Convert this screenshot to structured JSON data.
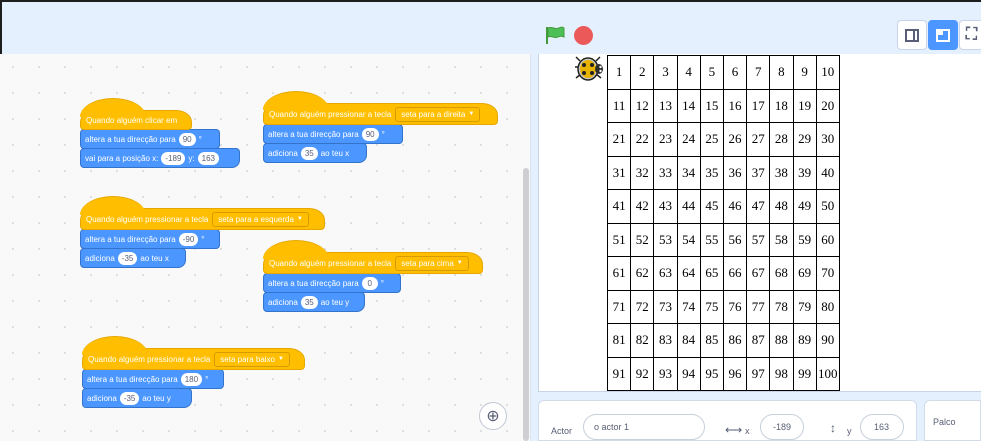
{
  "header": {
    "green_flag_icon": "green-flag-icon",
    "stop_icon": "stop-sign-icon",
    "layout_buttons": [
      "small-stage-icon",
      "large-stage-icon",
      "fullscreen-icon"
    ]
  },
  "scripts": {
    "s1": {
      "hat": "Quando alguém clicar em",
      "block1": {
        "text": "altera a tua direcção para",
        "value": "90",
        "suffix": "°"
      },
      "block2": {
        "text": "vai para a posição x:",
        "x": "-189",
        "ylabel": "y:",
        "y": "163"
      }
    },
    "s2": {
      "hat": "Quando alguém pressionar a tecla",
      "key": "seta para a direita",
      "block1": {
        "text": "altera a tua direcção para",
        "value": "90",
        "suffix": "°"
      },
      "block2": {
        "text": "adiciona",
        "value": "35",
        "suffix": "ao teu x"
      }
    },
    "s3": {
      "hat": "Quando alguém pressionar a tecla",
      "key": "seta para a esquerda",
      "block1": {
        "text": "altera a tua direcção para",
        "value": "-90",
        "suffix": "°"
      },
      "block2": {
        "text": "adiciona",
        "value": "-35",
        "suffix": "ao teu x"
      }
    },
    "s4": {
      "hat": "Quando alguém pressionar a tecla",
      "key": "seta para cima",
      "block1": {
        "text": "altera a tua direcção para",
        "value": "0",
        "suffix": "°"
      },
      "block2": {
        "text": "adiciona",
        "value": "35",
        "suffix": "ao teu y"
      }
    },
    "s5": {
      "hat": "Quando alguém pressionar a tecla",
      "key": "seta para baixo",
      "block1": {
        "text": "altera a tua direcção para",
        "value": "180",
        "suffix": "°"
      },
      "block2": {
        "text": "adiciona",
        "value": "-35",
        "suffix": "ao teu y"
      }
    }
  },
  "stage": {
    "grid": [
      [
        "1",
        "2",
        "3",
        "4",
        "5",
        "6",
        "7",
        "8",
        "9",
        "10"
      ],
      [
        "11",
        "12",
        "13",
        "14",
        "15",
        "16",
        "17",
        "18",
        "19",
        "20"
      ],
      [
        "21",
        "22",
        "23",
        "24",
        "25",
        "26",
        "27",
        "28",
        "29",
        "30"
      ],
      [
        "31",
        "32",
        "33",
        "34",
        "35",
        "36",
        "37",
        "38",
        "39",
        "40"
      ],
      [
        "41",
        "42",
        "43",
        "44",
        "45",
        "46",
        "47",
        "48",
        "49",
        "50"
      ],
      [
        "51",
        "52",
        "53",
        "54",
        "55",
        "56",
        "57",
        "58",
        "59",
        "60"
      ],
      [
        "61",
        "62",
        "63",
        "64",
        "65",
        "66",
        "67",
        "68",
        "69",
        "70"
      ],
      [
        "71",
        "72",
        "73",
        "74",
        "75",
        "76",
        "77",
        "78",
        "79",
        "80"
      ],
      [
        "81",
        "82",
        "83",
        "84",
        "85",
        "86",
        "87",
        "88",
        "89",
        "90"
      ],
      [
        "91",
        "92",
        "93",
        "94",
        "95",
        "96",
        "97",
        "98",
        "99",
        "100"
      ]
    ]
  },
  "sprite_info": {
    "actor_label": "Actor",
    "actor_name": "o actor 1",
    "x_label": "x",
    "x_value": "-189",
    "y_label": "y",
    "y_value": "163",
    "stage_label": "Palco"
  },
  "colors": {
    "events": "#ffbf00",
    "motion": "#4c97ff",
    "accent": "#4c97ff"
  }
}
